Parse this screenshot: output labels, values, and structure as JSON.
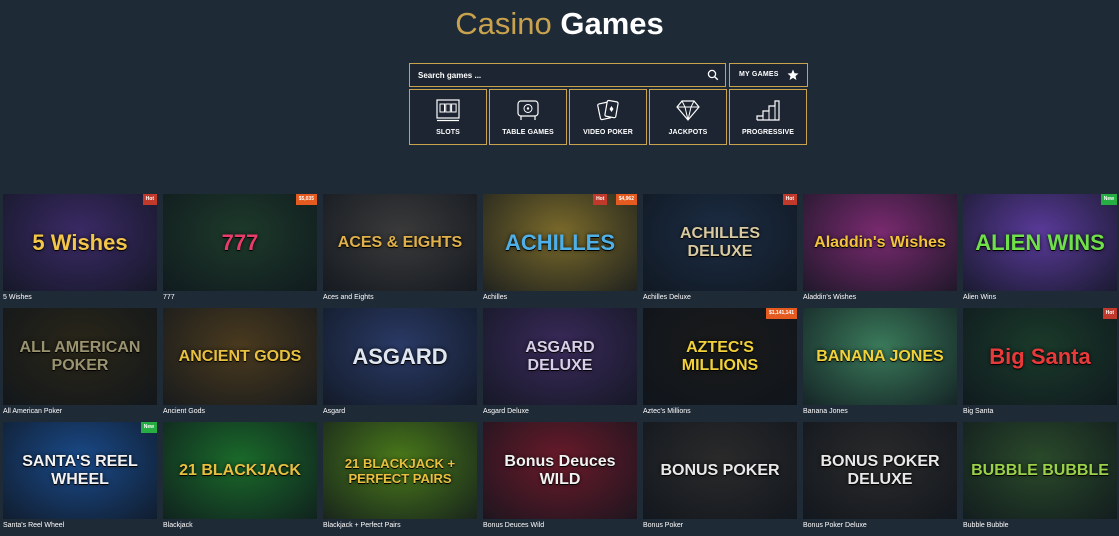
{
  "header": {
    "title_part1": "Casino",
    "title_part2": "Games"
  },
  "search": {
    "placeholder": "Search games ...",
    "my_games_label": "MY GAMES"
  },
  "categories": [
    {
      "label": "SLOTS",
      "icon": "slot-machine-icon"
    },
    {
      "label": "TABLE GAMES",
      "icon": "roulette-table-icon"
    },
    {
      "label": "VIDEO POKER",
      "icon": "playing-cards-icon"
    },
    {
      "label": "JACKPOTS",
      "icon": "diamond-icon"
    },
    {
      "label": "PROGRESSIVE",
      "icon": "stairs-icon"
    }
  ],
  "colors": {
    "accent": "#c9a24d",
    "background": "#1f2a37",
    "hot": "#c0392b",
    "new": "#27ae43",
    "jackpot": "#e45a1f"
  },
  "games": [
    {
      "name": "5 Wishes",
      "art": "5 Wishes",
      "badges": [
        {
          "text": "Hot",
          "kind": "hot"
        }
      ],
      "bg": "#3b2a66",
      "fg": "#f3c64a"
    },
    {
      "name": "777",
      "art": "777",
      "badges": [
        {
          "text": "$5,035",
          "kind": "jack"
        }
      ],
      "bg": "#1d3a2a",
      "fg": "#e83d6b"
    },
    {
      "name": "Aces and Eights",
      "art": "ACES & EIGHTS",
      "badges": [],
      "bg": "#3a3a3a",
      "fg": "#e0b14a"
    },
    {
      "name": "Achilles",
      "art": "ACHILLES",
      "badges": [
        {
          "text": "Hot",
          "kind": "hot"
        },
        {
          "text": "$4,962",
          "kind": "jack"
        }
      ],
      "bg": "#7a6a2a",
      "fg": "#4fb0e8"
    },
    {
      "name": "Achilles Deluxe",
      "art": "ACHILLES DELUXE",
      "badges": [
        {
          "text": "Hot",
          "kind": "hot"
        }
      ],
      "bg": "#1c2d44",
      "fg": "#d8c9a0"
    },
    {
      "name": "Aladdin's Wishes",
      "art": "Aladdin's Wishes",
      "badges": [],
      "bg": "#7a2a70",
      "fg": "#f2c43a"
    },
    {
      "name": "Alien Wins",
      "art": "ALIEN WINS",
      "badges": [
        {
          "text": "New",
          "kind": "new"
        }
      ],
      "bg": "#5a3a9a",
      "fg": "#6fe04a"
    },
    {
      "name": "All American Poker",
      "art": "ALL AMERICAN POKER",
      "badges": [],
      "bg": "#2a2618",
      "fg": "#9a9370"
    },
    {
      "name": "Ancient Gods",
      "art": "ANCIENT GODS",
      "badges": [],
      "bg": "#4a3a1e",
      "fg": "#e8c040"
    },
    {
      "name": "Asgard",
      "art": "ASGARD",
      "badges": [],
      "bg": "#2a3a66",
      "fg": "#e0e6f0"
    },
    {
      "name": "Asgard Deluxe",
      "art": "ASGARD DELUXE",
      "badges": [],
      "bg": "#3a2a5a",
      "fg": "#d8d0e8"
    },
    {
      "name": "Aztec's Millions",
      "art": "AZTEC'S MILLIONS",
      "badges": [
        {
          "text": "$1,141,141",
          "kind": "jack"
        }
      ],
      "bg": "#1a1a1a",
      "fg": "#f2d23a"
    },
    {
      "name": "Banana Jones",
      "art": "BANANA JONES",
      "badges": [],
      "bg": "#3a7a5a",
      "fg": "#f2d23a"
    },
    {
      "name": "Big Santa",
      "art": "Big Santa",
      "badges": [
        {
          "text": "Hot",
          "kind": "hot"
        }
      ],
      "bg": "#1a3a2a",
      "fg": "#e83a3a"
    },
    {
      "name": "Santa's Reel Wheel",
      "art": "SANTA'S REEL WHEEL",
      "badges": [
        {
          "text": "New",
          "kind": "new"
        }
      ],
      "bg": "#1a4a8a",
      "fg": "#f2f2f2"
    },
    {
      "name": "Blackjack",
      "art": "21 BLACKJACK",
      "badges": [],
      "bg": "#1a6a2a",
      "fg": "#e8c040"
    },
    {
      "name": "Blackjack + Perfect Pairs",
      "art": "21 BLACKJACK + PERFECT PAIRS",
      "badges": [],
      "bg": "#4a7a1a",
      "fg": "#e8c040"
    },
    {
      "name": "Bonus Deuces Wild",
      "art": "Bonus Deuces WILD",
      "badges": [],
      "bg": "#6a1a2a",
      "fg": "#f2f2f2"
    },
    {
      "name": "Bonus Poker",
      "art": "BONUS POKER",
      "badges": [],
      "bg": "#2a2a2a",
      "fg": "#e8e8e8"
    },
    {
      "name": "Bonus Poker Deluxe",
      "art": "BONUS POKER DELUXE",
      "badges": [],
      "bg": "#2a2a2a",
      "fg": "#e8e8e8"
    },
    {
      "name": "Bubble Bubble",
      "art": "BUBBLE BUBBLE",
      "badges": [],
      "bg": "#2a4a2a",
      "fg": "#9ad04a"
    }
  ]
}
